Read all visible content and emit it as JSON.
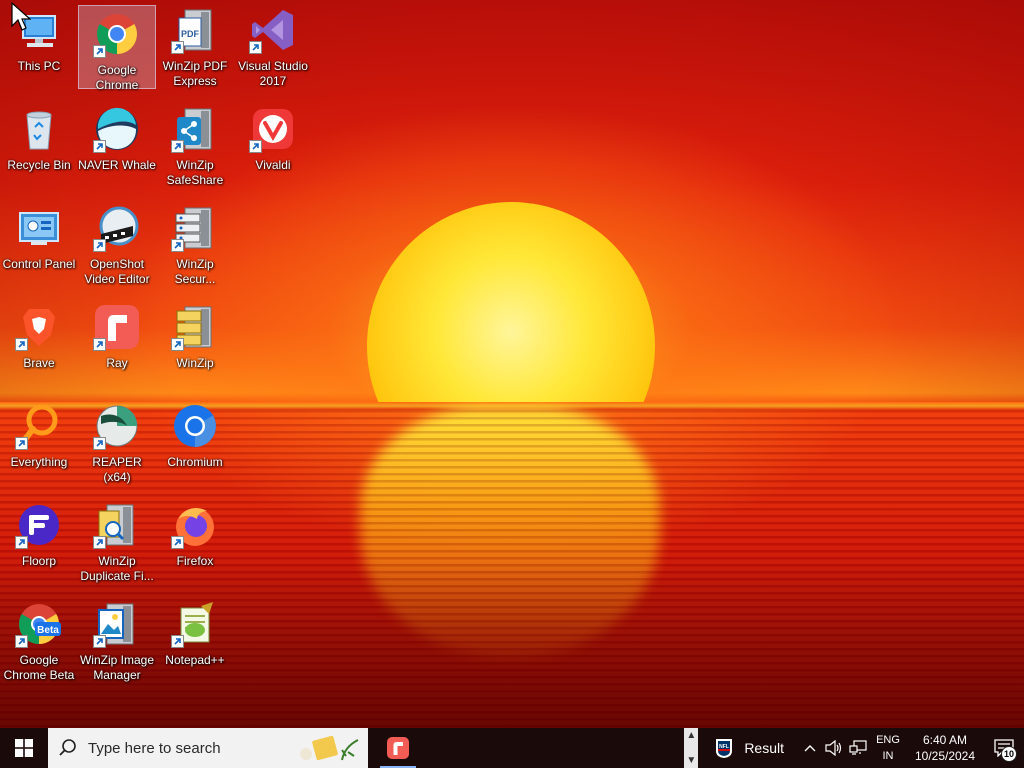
{
  "desktop": {
    "icons": [
      {
        "label": "This PC",
        "icon": "this-pc-icon"
      },
      {
        "label": "Google\nChrome",
        "icon": "chrome-icon",
        "selected": true
      },
      {
        "label": "WinZip PDF\nExpress",
        "icon": "winzip-pdf-icon"
      },
      {
        "label": "Visual Studio\n2017",
        "icon": "visual-studio-icon"
      },
      {
        "label": "Recycle Bin",
        "icon": "recycle-bin-icon"
      },
      {
        "label": "NAVER Whale",
        "icon": "naver-whale-icon"
      },
      {
        "label": "WinZip\nSafeShare",
        "icon": "winzip-safeshare-icon"
      },
      {
        "label": "Vivaldi",
        "icon": "vivaldi-icon"
      },
      {
        "label": "Control Panel",
        "icon": "control-panel-icon"
      },
      {
        "label": "OpenShot\nVideo Editor",
        "icon": "openshot-icon"
      },
      {
        "label": "WinZip\nSecur...",
        "icon": "winzip-secure-icon"
      },
      {
        "label": "Brave",
        "icon": "brave-icon"
      },
      {
        "label": "Ray",
        "icon": "ray-icon"
      },
      {
        "label": "WinZip",
        "icon": "winzip-icon"
      },
      {
        "label": "Everything",
        "icon": "everything-icon"
      },
      {
        "label": "REAPER (x64)",
        "icon": "reaper-icon"
      },
      {
        "label": "Chromium",
        "icon": "chromium-icon"
      },
      {
        "label": "Floorp",
        "icon": "floorp-icon"
      },
      {
        "label": "WinZip\nDuplicate Fi...",
        "icon": "winzip-duplicate-icon"
      },
      {
        "label": "Firefox",
        "icon": "firefox-icon"
      },
      {
        "label": "Google\nChrome Beta",
        "icon": "chrome-beta-icon"
      },
      {
        "label": "WinZip Image\nManager",
        "icon": "winzip-image-icon"
      },
      {
        "label": "Notepad++",
        "icon": "notepadpp-icon"
      }
    ]
  },
  "taskbar": {
    "search_placeholder": "Type here to search",
    "pinned_app": "ray-icon",
    "news_label": "Result",
    "lang_top": "ENG",
    "lang_bottom": "IN",
    "time": "6:40 AM",
    "date": "10/25/2024",
    "notification_count": "10",
    "chevron": "^"
  },
  "colors": {
    "taskbar_bg": "#1a0a0a",
    "search_bg": "#f2f2f2",
    "selection": "rgba(200,200,220,0.35)"
  }
}
